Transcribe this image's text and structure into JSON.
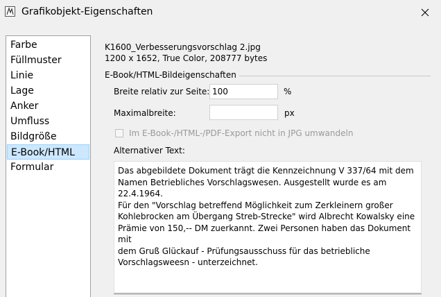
{
  "window": {
    "title": "Grafikobjekt-Eigenschaften",
    "icon": "app-icon",
    "close_icon": "close-icon"
  },
  "sidebar": {
    "items": [
      {
        "label": "Farbe"
      },
      {
        "label": "Füllmuster"
      },
      {
        "label": "Linie"
      },
      {
        "label": "Lage"
      },
      {
        "label": "Anker"
      },
      {
        "label": "Umfluss"
      },
      {
        "label": "Bildgröße"
      },
      {
        "label": "E-Book/HTML",
        "selected": true
      },
      {
        "label": "Formular"
      }
    ]
  },
  "file": {
    "name": "K1600_Verbesserungsvorschlag 2.jpg",
    "info": "1200 x 1652, True Color, 208777 bytes"
  },
  "ebook": {
    "group_label": "E-Book/HTML-Bildeigenschaften",
    "width_label": "Breite relativ zur Seite:",
    "width_value": "100",
    "width_unit": "%",
    "maxwidth_label": "Maximalbreite:",
    "maxwidth_value": "",
    "maxwidth_unit": "px",
    "jpg_checkbox_label": "Im E-Book-/HTML-/PDF-Export nicht in JPG umwandeln",
    "jpg_checkbox_checked": false,
    "alt_label": "Alternativer Text:",
    "alt_text": "Das abgebildete Dokument trägt die Kennzeichnung V 337/64 mit dem\nNamen Betriebliches Vorschlagswesen. Ausgestellt wurde es am 22.4.1964.\nFür den \"Vorschlag betreffend Möglichkeit zum Zerkleinern großer\nKohlebrocken am Übergang Streb-Strecke\" wird Albrecht Kowalsky eine\nPrämie von 150,-- DM zuerkannt. Zwei Personen haben das Dokument mit\ndem Gruß Glückauf - Prüfungsausschuss für das betriebliche\nVorschlagsweesn - unterzeichnet."
  }
}
